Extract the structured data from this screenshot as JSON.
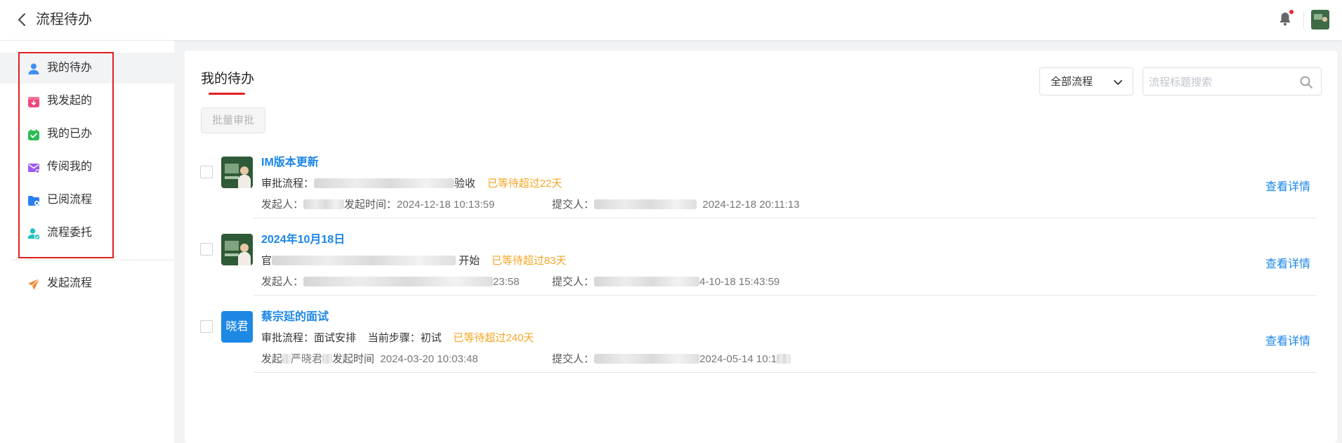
{
  "header": {
    "title": "流程待办"
  },
  "sidebar": {
    "items": [
      {
        "label": "我的待办",
        "icon": "person-icon",
        "color": "#3f8ff0"
      },
      {
        "label": "我发起的",
        "icon": "inbox-download-icon",
        "color": "#f0477a"
      },
      {
        "label": "我的已办",
        "icon": "check-bag-icon",
        "color": "#2ebc55"
      },
      {
        "label": "传阅我的",
        "icon": "mail-icon",
        "color": "#9b59f5"
      },
      {
        "label": "已阅流程",
        "icon": "folder-eye-icon",
        "color": "#2a7ef0"
      },
      {
        "label": "流程委托",
        "icon": "user-delegate-icon",
        "color": "#1fc2c2"
      },
      {
        "label": "发起流程",
        "icon": "paper-plane-icon",
        "color": "#f5832a"
      }
    ]
  },
  "main": {
    "title": "我的待办",
    "filter": {
      "value": "全部流程"
    },
    "search": {
      "placeholder": "流程标题搜索"
    },
    "batch_label": "批量审批",
    "detail_label": "查看详情",
    "tasks": [
      {
        "title": "IM版本更新",
        "line2_prefix": "审批流程：",
        "line2_tail": "验收",
        "wait": "已等待超过22天",
        "initiator_label": "发起人：",
        "time_label": "发起时间：",
        "start_time": "2024-12-18 10:13:59",
        "submitter_label": "提交人：",
        "submit_time": "2024-12-18 20:11:13"
      },
      {
        "title": "2024年10月18日",
        "line2_prefix": "官",
        "line2_tail": "开始",
        "wait": "已等待超过83天",
        "initiator_label": "发起人：",
        "start_time_partial": "23:58",
        "submitter_label": "提交人：",
        "submit_time_partial": "4-10-18 15:43:59"
      },
      {
        "title": "蔡宗延的面试",
        "avatar_text": "晓君",
        "flow_label": "审批流程：",
        "flow_value": "面试安排",
        "step_label": "当前步骤：",
        "step_value": "初试",
        "wait": "已等待超过240天",
        "initiator_label": "发起",
        "initiator_partial": "严晓君",
        "time_label": "发起时间",
        "start_time": "2024-03-20 10:03:48",
        "submitter_label": "提交人：",
        "submit_time_partial": "2024-05-14 10:1"
      }
    ]
  }
}
